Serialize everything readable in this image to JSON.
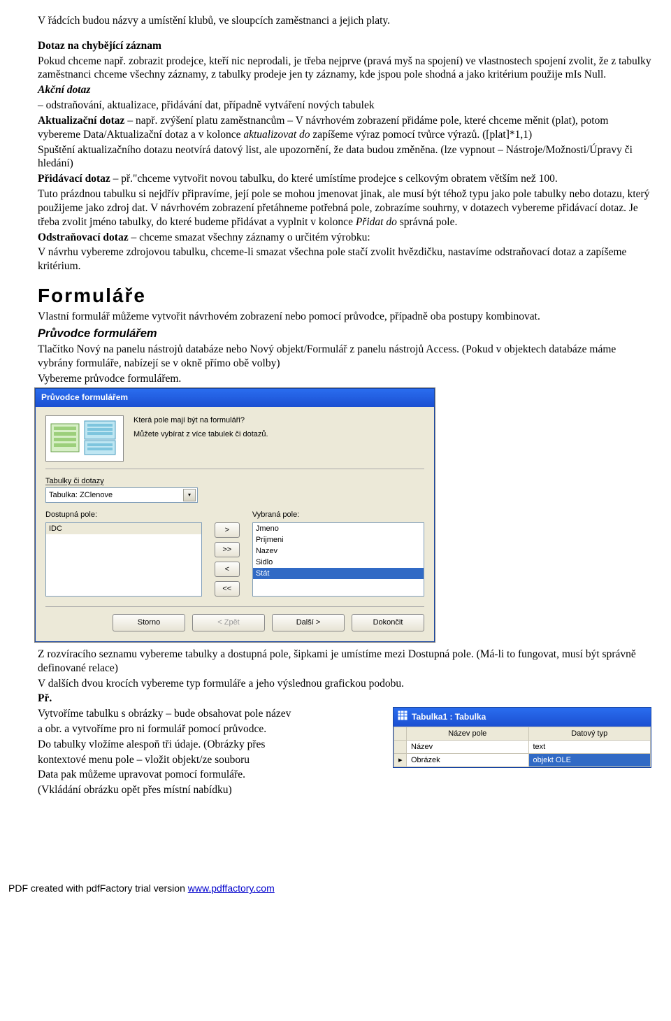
{
  "para": {
    "intro": "V řádcích budou názvy a umístění klubů, ve sloupcích zaměstnanci a jejich platy.",
    "missing_title": "Dotaz na chybějící záznam",
    "missing_body": "Pokud chceme např. zobrazit prodejce, kteří nic neprodali, je třeba nejprve (pravá myš na spojení) ve vlastnostech spojení zvolit, že z tabulky zaměstnanci chceme všechny záznamy, z tabulky prodeje jen ty záznamy, kde jspou pole shodná a jako kritérium použije mIs Null.",
    "akcni_title": "Akční dotaz",
    "akcni_line1": "– odstraňování, aktualizace, přidávání dat, případně vytváření nových tabulek",
    "akt_label": "Aktualizační dotaz",
    "akt_rest": " – např. zvýšení platu zaměstnancům – V návrhovém zobrazení přidáme pole, které chceme měnit (plat), potom vybereme Data/Aktualizační dotaz a v kolonce ",
    "akt_italic": "aktualizovat do",
    "akt_rest2": " zapíšeme výraz pomocí tvůrce výrazů. ([plat]*1,1)",
    "akt_run": "Spuštění aktualizačního dotazu neotvírá datový list, ale upozornění, že data budou změněna. (lze vypnout – Nástroje/Možnosti/Úpravy či hledání)",
    "prid_label": "Přidávací dotaz",
    "prid_rest": " – př.\"chceme vytvořit novou tabulku, do které umístíme prodejce s celkovým obratem větším než 100.",
    "prid_body": "Tuto prázdnou tabulku si nejdřív připravíme, její pole se mohou jmenovat jinak, ale musí být téhož typu jako pole tabulky nebo dotazu, který použijeme jako zdroj dat. V návrhovém zobrazení přetáhneme potřebná pole, zobrazíme souhrny, v dotazech vybereme přidávací dotaz. Je třeba zvolit jméno tabulky, do které budeme přidávat a vyplnit v kolonce ",
    "prid_italic": "Přidat do",
    "prid_tail": " správná pole.",
    "odstr_label": "Odstraňovací dotaz",
    "odstr_rest": " – chceme smazat všechny záznamy o určitém výrobku:",
    "odstr_body": "V návrhu vybereme zdrojovou tabulku, chceme-li smazat všechna pole stačí zvolit hvězdičku, nastavíme odstraňovací dotaz a zapíšeme kritérium."
  },
  "formulare": {
    "heading": "Formuláře",
    "p1": "Vlastní formulář můžeme vytvořit návrhovém zobrazení nebo pomocí průvodce, případně oba postupy kombinovat.",
    "sub": "Průvodce formulářem",
    "p2": "Tlačítko Nový na panelu nástrojů databáze nebo Nový objekt/Formulář z panelu nástrojů Access. (Pokud v objektech databáze máme vybrány formuláře, nabízejí se v okně přímo obě volby)",
    "p3": "Vybereme průvodce formulářem."
  },
  "wizard": {
    "title": "Průvodce formulářem",
    "q1": "Která pole mají být na formuláři?",
    "q2": "Můžete vybírat z více tabulek či dotazů.",
    "tables_label": "Tabulky či dotazy",
    "table_selected": "Tabulka: ZClenove",
    "available_label": "Dostupná pole:",
    "selected_label": "Vybraná pole:",
    "available": [
      "IDC"
    ],
    "selected": [
      "Jmeno",
      "Prijmeni",
      "Nazev",
      "Sidlo",
      "Stát"
    ],
    "btn_add": ">",
    "btn_addall": ">>",
    "btn_remove": "<",
    "btn_removeall": "<<",
    "btn_cancel": "Storno",
    "btn_back": "< Zpět",
    "btn_next": "Další >",
    "btn_finish": "Dokončit"
  },
  "after_wizard": {
    "p1": "Z rozvíracího seznamu vybereme tabulky a dostupná pole, šipkami je umístíme mezi Dostupná pole. (Má-li to fungovat, musí být správně definované relace)",
    "p2": "V dalších dvou krocích vybereme typ formuláře a jeho výslednou grafickou podobu.",
    "pr": "Př.",
    "p3a": "Vytvoříme tabulku s obrázky – bude obsahovat pole název",
    "p3b": "a obr. a vytvoříme pro ni formulář pomocí průvodce.",
    "p3c": "Do tabulky vložíme alespoň tři údaje. (Obrázky přes",
    "p3d": "kontextové menu pole – vložit objekt/ze souboru",
    "p3e": "Data pak můžeme upravovat pomocí formuláře.",
    "p3f": "(Vkládání obrázku opět přes místní nabídku)"
  },
  "tablewin": {
    "title": "Tabulka1 : Tabulka",
    "col1": "Název pole",
    "col2": "Datový typ",
    "rows": [
      {
        "c1": "Název",
        "c2": "text"
      },
      {
        "c1": "Obrázek",
        "c2": "objekt OLE"
      }
    ]
  },
  "footer": {
    "pre": "PDF created with pdfFactory trial version ",
    "link": "www.pdffactory.com"
  }
}
